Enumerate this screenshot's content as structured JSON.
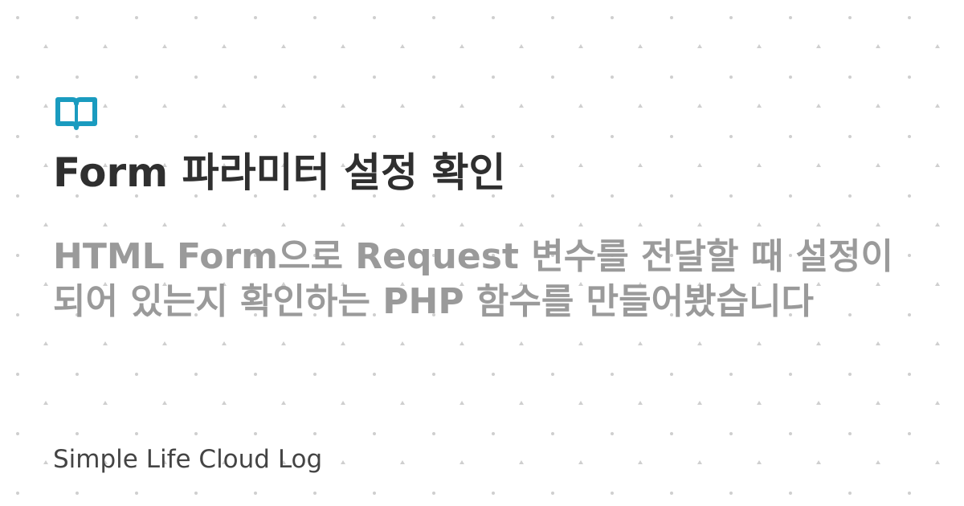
{
  "card": {
    "icon": "open-book-icon",
    "accent_color": "#1a9bbf",
    "title": "Form 파라미터 설정 확인",
    "subtitle_lines": [
      "HTML Form으로 Request 변수를 전달할 때 설정이",
      "되어 있는지 확인하는 PHP 함수를 만들어봤습니다"
    ],
    "site_name": "Simple Life Cloud Log",
    "title_color": "#2f2f2f",
    "subtitle_color": "#9a9a9a",
    "site_name_color": "#444444",
    "pattern_color": "#cfcfcf"
  }
}
